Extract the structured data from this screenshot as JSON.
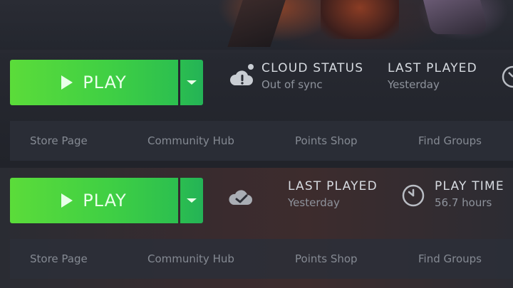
{
  "sections": [
    {
      "play_label": "PLAY",
      "stats": [
        {
          "title": "CLOUD STATUS",
          "value": "Out of sync"
        },
        {
          "title": "LAST PLAYED",
          "value": "Yesterday"
        }
      ],
      "nav": [
        "Store Page",
        "Community Hub",
        "Points Shop",
        "Find Groups"
      ]
    },
    {
      "play_label": "PLAY",
      "stats": [
        {
          "title": "LAST PLAYED",
          "value": "Yesterday"
        },
        {
          "title": "PLAY TIME",
          "value": "56.7 hours"
        }
      ],
      "nav": [
        "Store Page",
        "Community Hub",
        "Points Shop",
        "Find Groups"
      ]
    }
  ],
  "colors": {
    "play_green": "#3fcf44",
    "text_primary": "#d7dbe1",
    "text_secondary": "#8e939c"
  },
  "icons": [
    "play-icon",
    "chevron-down-icon",
    "cloud-alert-icon",
    "clock-icon",
    "cloud-check-icon"
  ]
}
